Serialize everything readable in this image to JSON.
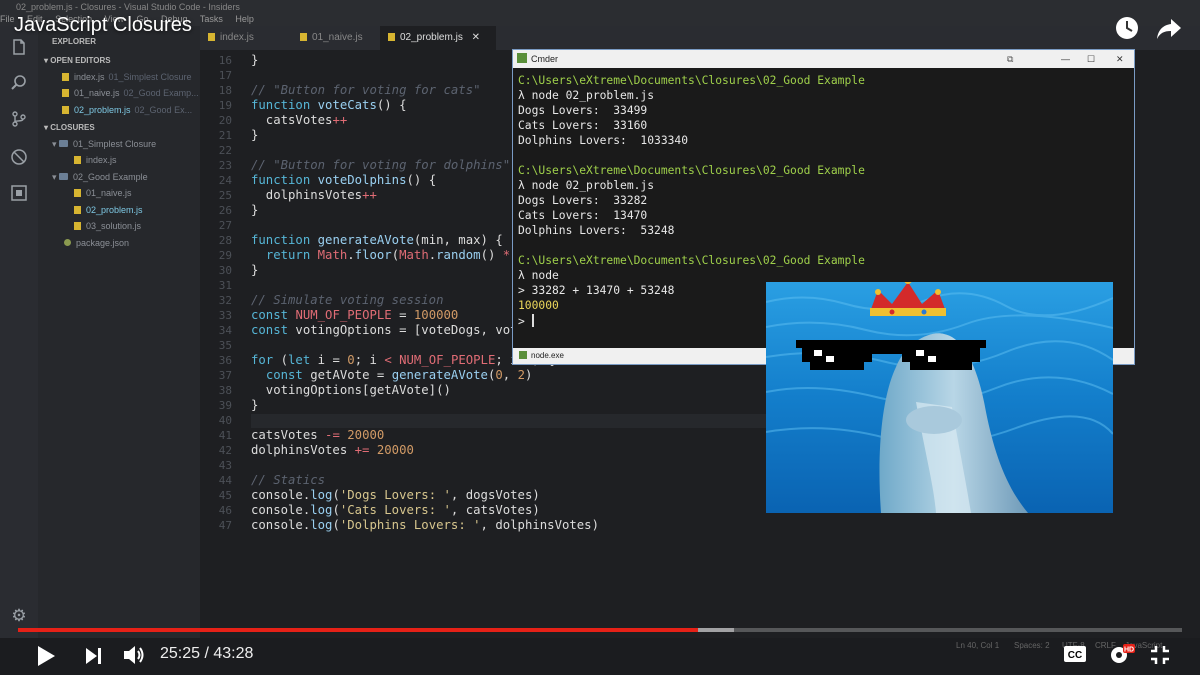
{
  "window": {
    "vscode_title": "02_problem.js - Closures - Visual Studio Code - Insiders",
    "menu": [
      "File",
      "Edit",
      "Selection",
      "View",
      "Go",
      "Debug",
      "Tasks",
      "Help"
    ]
  },
  "video": {
    "title": "JavaScript Closures",
    "current_time": "25:25",
    "duration": "43:28",
    "time_display": "25:25 / 43:28",
    "progress_fraction": 0.584,
    "buffered_fraction": 0.615
  },
  "sidebar": {
    "header": "EXPLORER",
    "open_editors_label": "OPEN EDITORS",
    "open_editors": [
      {
        "name": "index.js",
        "dir": "01_Simplest Closure"
      },
      {
        "name": "01_naive.js",
        "dir": "02_Good Examp..."
      },
      {
        "name": "02_problem.js",
        "dir": "02_Good Ex..."
      }
    ],
    "project_label": "CLOSURES",
    "tree": [
      {
        "label": "01_Simplest Closure",
        "type": "folder"
      },
      {
        "label": "index.js",
        "type": "file"
      },
      {
        "label": "02_Good Example",
        "type": "folder"
      },
      {
        "label": "01_naive.js",
        "type": "file"
      },
      {
        "label": "02_problem.js",
        "type": "file"
      },
      {
        "label": "03_solution.js",
        "type": "file"
      },
      {
        "label": "package.json",
        "type": "json"
      }
    ]
  },
  "tabs": [
    {
      "label": "index.js"
    },
    {
      "label": "01_naive.js"
    },
    {
      "label": "02_problem.js"
    }
  ],
  "editor": {
    "line_numbers": [
      "16",
      "17",
      "18",
      "19",
      "20",
      "21",
      "22",
      "23",
      "24",
      "25",
      "26",
      "27",
      "28",
      "29",
      "30",
      "31",
      "32",
      "33",
      "34",
      "35",
      "36",
      "37",
      "38",
      "39",
      "40",
      "41",
      "42",
      "43",
      "44",
      "45",
      "46",
      "47"
    ]
  },
  "terminal": {
    "title": "Cmder",
    "tab_label": "node.exe",
    "session1": {
      "path": "C:\\Users\\eXtreme\\Documents\\Closures\\02_Good Example",
      "command": "λ node 02_problem.js",
      "dogs": "Dogs Lovers:  33499",
      "cats": "Cats Lovers:  33160",
      "dolphins": "Dolphins Lovers:  1033340"
    },
    "session2": {
      "path": "C:\\Users\\eXtreme\\Documents\\Closures\\02_Good Example",
      "command": "λ node 02_problem.js",
      "dogs": "Dogs Lovers:  33282",
      "cats": "Cats Lovers:  13470",
      "dolphins": "Dolphins Lovers:  53248"
    },
    "session3": {
      "path": "C:\\Users\\eXtreme\\Documents\\Closures\\02_Good Example",
      "command": "λ node",
      "expr": "> 33282 + 13470 + 53248",
      "result": "100000",
      "prompt": ">"
    }
  },
  "status": {
    "position": "Ln 40, Col 1",
    "spaces": "Spaces: 2",
    "encoding": "UTF-8",
    "eol": "CRLF",
    "language": "JavaScript"
  },
  "colors": {
    "progress": "#e62117",
    "terminal_path": "#9fd04b",
    "js_icon": "#d7b531",
    "keyword": "#56b6d7"
  }
}
